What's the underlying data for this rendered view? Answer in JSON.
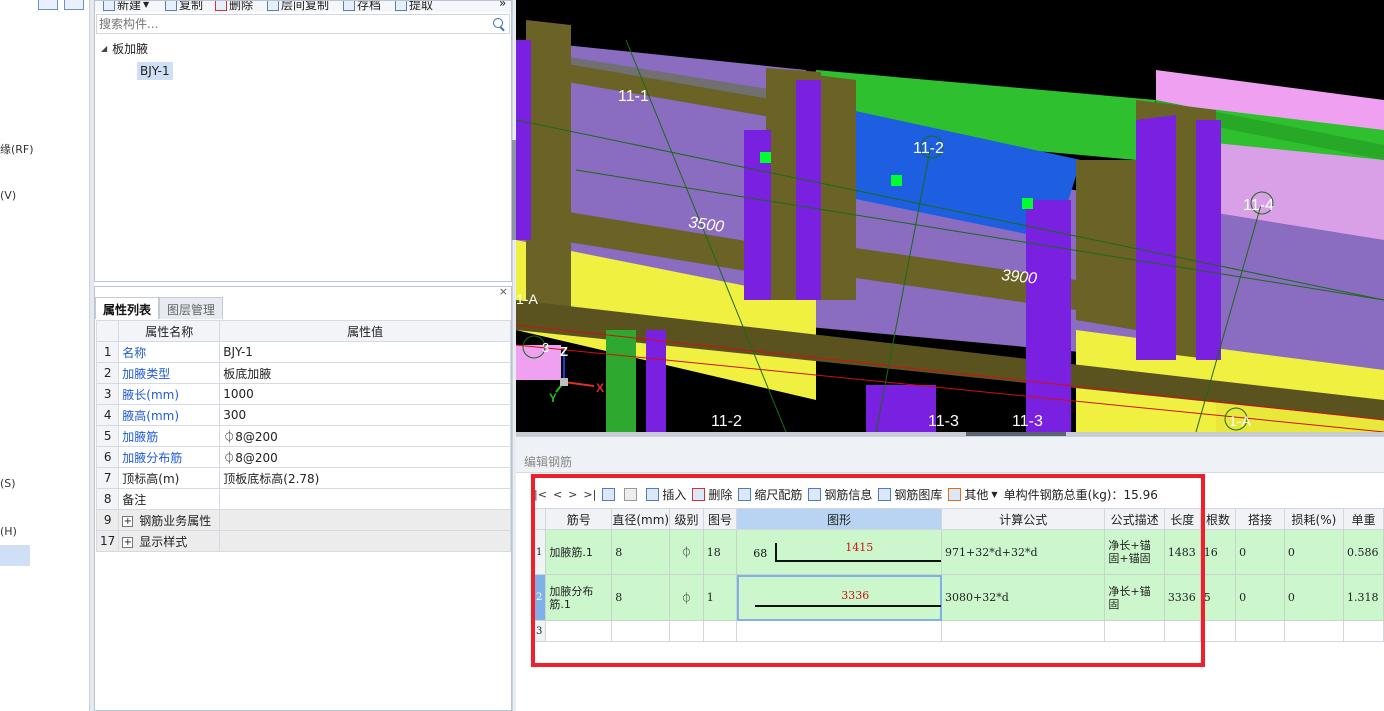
{
  "left_strip": {
    "fragments": [
      "缘(RF)",
      "(V)",
      "(S)",
      "(H)"
    ]
  },
  "component_panel": {
    "toolbar": {
      "new_label": "新建",
      "copy_label": "复制",
      "delete_label": "删除",
      "floor_copy_label": "层间复制",
      "save_label": "存档",
      "extract_label": "提取",
      "more_label": "»"
    },
    "search_placeholder": "搜索构件...",
    "tree": {
      "root_label": "板加腋",
      "child_label": "BJY-1"
    }
  },
  "property_panel": {
    "tabs": [
      "属性列表",
      "图层管理"
    ],
    "header_name": "属性名称",
    "header_value": "属性值",
    "rows": [
      {
        "no": "1",
        "name": "名称",
        "value": "BJY-1",
        "blue": true
      },
      {
        "no": "2",
        "name": "加腋类型",
        "value": "板底加腋",
        "blue": true
      },
      {
        "no": "3",
        "name": "腋长(mm)",
        "value": "1000",
        "blue": true
      },
      {
        "no": "4",
        "name": "腋高(mm)",
        "value": "300",
        "blue": true
      },
      {
        "no": "5",
        "name": "加腋筋",
        "value": "⏀8@200",
        "blue": true
      },
      {
        "no": "6",
        "name": "加腋分布筋",
        "value": "⏀8@200",
        "blue": true
      },
      {
        "no": "7",
        "name": "顶标高(m)",
        "value": "顶板底标高(2.78)",
        "blue": false
      },
      {
        "no": "8",
        "name": "备注",
        "value": "",
        "blue": false
      },
      {
        "no": "9",
        "name": "钢筋业务属性",
        "value": "",
        "group": true
      },
      {
        "no": "17",
        "name": "显示样式",
        "value": "",
        "group": true
      }
    ]
  },
  "viewport": {
    "labels": {
      "grid_11_1": "11-1",
      "grid_11_2_top": "11-2",
      "grid_11_4": "11-4",
      "dim_3500": "3500",
      "dim_3900": "3900",
      "grid_11_2_bottom": "11-2",
      "grid_11_3_a": "11-3",
      "grid_11_3_b": "11-3",
      "grid_a_left": "1-A",
      "grid_a_right": "1-A",
      "grid_3": "3",
      "axis_z": "Z",
      "axis_x": "X",
      "axis_y": "Y"
    },
    "colors": {
      "background": "#000000",
      "beam_olive": "#6b6226",
      "slab_purple": "#8a6cc0",
      "column_violet": "#7a20e0",
      "slab_green": "#2ec02e",
      "slab_blue": "#1e5ee0",
      "wall_pink": "#f0a0f0",
      "wall_yellow": "#f0f040"
    }
  },
  "rebar_editor": {
    "title": "编辑钢筋",
    "toolbar": {
      "nav": [
        "|<",
        "<",
        ">",
        ">|"
      ],
      "insert_label": "插入",
      "delete_label": "删除",
      "scale_label": "缩尺配筋",
      "info_label": "钢筋信息",
      "library_label": "钢筋图库",
      "other_label": "其他",
      "total_weight": "单构件钢筋总重(kg)：15.96"
    },
    "columns": [
      "筋号",
      "直径(mm)",
      "级别",
      "图号",
      "图形",
      "计算公式",
      "公式描述",
      "长度",
      "根数",
      "搭接",
      "损耗(%)",
      "单重"
    ],
    "rows": [
      {
        "no": "1",
        "name": "加腋筋.1",
        "diameter": "8",
        "grade": "⏀",
        "figure_no": "18",
        "shape_left": "68",
        "shape_value": "1415",
        "formula": "971+32*d+32*d",
        "description": "净长+锚固+锚固",
        "length": "1483",
        "count": "16",
        "lap": "0",
        "loss": "0",
        "unit_weight": "0.586"
      },
      {
        "no": "2",
        "name": "加腋分布筋.1",
        "diameter": "8",
        "grade": "⏀",
        "figure_no": "1",
        "shape_left": "",
        "shape_value": "3336",
        "formula": "3080+32*d",
        "description": "净长+锚固",
        "length": "3336",
        "count": "5",
        "lap": "0",
        "loss": "0",
        "unit_weight": "1.318"
      },
      {
        "no": "3",
        "name": "",
        "diameter": "",
        "grade": "",
        "figure_no": "",
        "shape_left": "",
        "shape_value": "",
        "formula": "",
        "description": "",
        "length": "",
        "count": "",
        "lap": "",
        "loss": "",
        "unit_weight": ""
      }
    ]
  },
  "highlight_color": "#f0202a"
}
